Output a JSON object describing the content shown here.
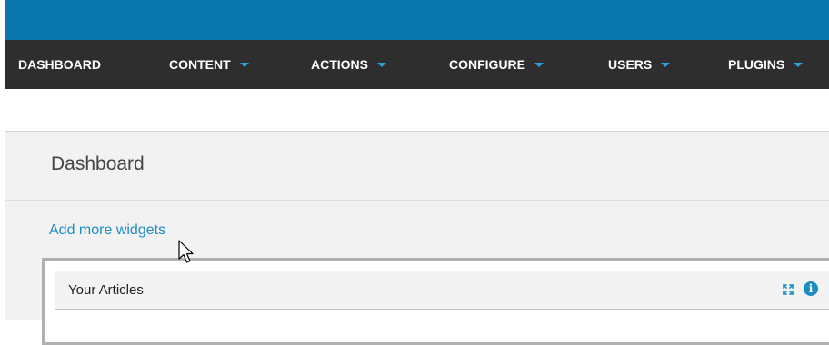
{
  "nav": {
    "items": [
      {
        "label": "DASHBOARD",
        "has_dropdown": false
      },
      {
        "label": "CONTENT",
        "has_dropdown": true
      },
      {
        "label": "ACTIONS",
        "has_dropdown": true
      },
      {
        "label": "CONFIGURE",
        "has_dropdown": true
      },
      {
        "label": "USERS",
        "has_dropdown": true
      },
      {
        "label": "PLUGINS",
        "has_dropdown": true
      }
    ]
  },
  "page": {
    "title": "Dashboard",
    "add_widgets_label": "Add more widgets"
  },
  "widgets": [
    {
      "title": "Your Articles",
      "icons": [
        "maximise-icon",
        "info-icon"
      ]
    }
  ],
  "icons": {
    "info_glyph": "i",
    "cursor": "mouse-pointer-icon"
  },
  "colors": {
    "topbar": "#0a78ad",
    "navbar": "#2e2e2e",
    "accent": "#29a3dd",
    "link": "#1e8cc4",
    "content_bg": "#f2f2f2"
  }
}
